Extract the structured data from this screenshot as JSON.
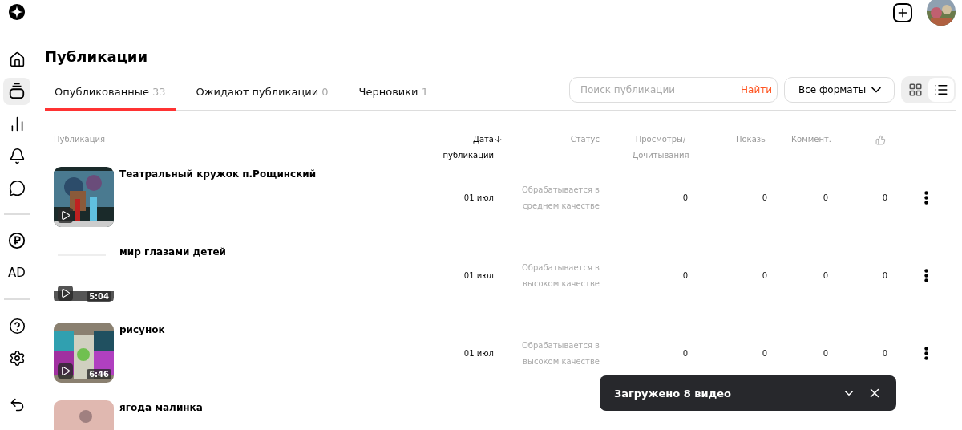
{
  "sidebar": {
    "items": [
      {
        "kind": "icon",
        "selected": false
      },
      {
        "kind": "icon",
        "selected": true
      },
      {
        "kind": "icon",
        "selected": false
      },
      {
        "kind": "icon",
        "selected": false
      },
      {
        "kind": "icon",
        "selected": false
      },
      {
        "kind": "divider"
      },
      {
        "kind": "icon",
        "selected": false
      },
      {
        "kind": "text",
        "label": "AD",
        "selected": false
      },
      {
        "kind": "divider"
      },
      {
        "kind": "icon",
        "selected": false
      },
      {
        "kind": "icon",
        "selected": false
      },
      {
        "kind": "spacer"
      },
      {
        "kind": "icon",
        "selected": false
      }
    ]
  },
  "title": "Публикации",
  "tabs": [
    {
      "label": "Опубликованные",
      "count": "33",
      "selected": true
    },
    {
      "label": "Ожидают публикации",
      "count": "0",
      "selected": false
    },
    {
      "label": "Черновики",
      "count": "1",
      "selected": false
    }
  ],
  "search": {
    "placeholder": "Поиск публикации",
    "button": "Найти"
  },
  "format_select": {
    "value": "Все форматы"
  },
  "view_toggle": [
    {
      "kind": "grid",
      "selected": false
    },
    {
      "kind": "list",
      "selected": true
    }
  ],
  "table": {
    "columns": [
      {
        "kind": "publication",
        "label": "Публикация"
      },
      {
        "kind": "date",
        "label": "Дата публикации",
        "sorted": true
      },
      {
        "kind": "status",
        "label": "Статус"
      },
      {
        "kind": "views",
        "label": "Просмотры/Дочитывания"
      },
      {
        "kind": "shows",
        "label": "Показы"
      },
      {
        "kind": "comments",
        "label": "Коммент."
      },
      {
        "kind": "likes"
      }
    ],
    "rows": [
      {
        "title": "Театральный кружок п.Рощинский",
        "duration": null,
        "date": "01 июл",
        "status": "Обрабатывается в среднем качестве",
        "views": "0",
        "shows": "0",
        "comments": "0",
        "likes": "0"
      },
      {
        "title": "мир глазами детей",
        "duration": "5:04",
        "date": "01 июл",
        "status": "Обрабатывается в высоком качестве",
        "views": "0",
        "shows": "0",
        "comments": "0",
        "likes": "0"
      },
      {
        "title": "рисунок",
        "duration": "6:46",
        "date": "01 июл",
        "status": "Обрабатывается в высоком качестве",
        "views": "0",
        "shows": "0",
        "comments": "0",
        "likes": "0"
      },
      {
        "title": "ягода малинка"
      }
    ]
  },
  "toast": {
    "text": "Загружено 8 видео"
  }
}
